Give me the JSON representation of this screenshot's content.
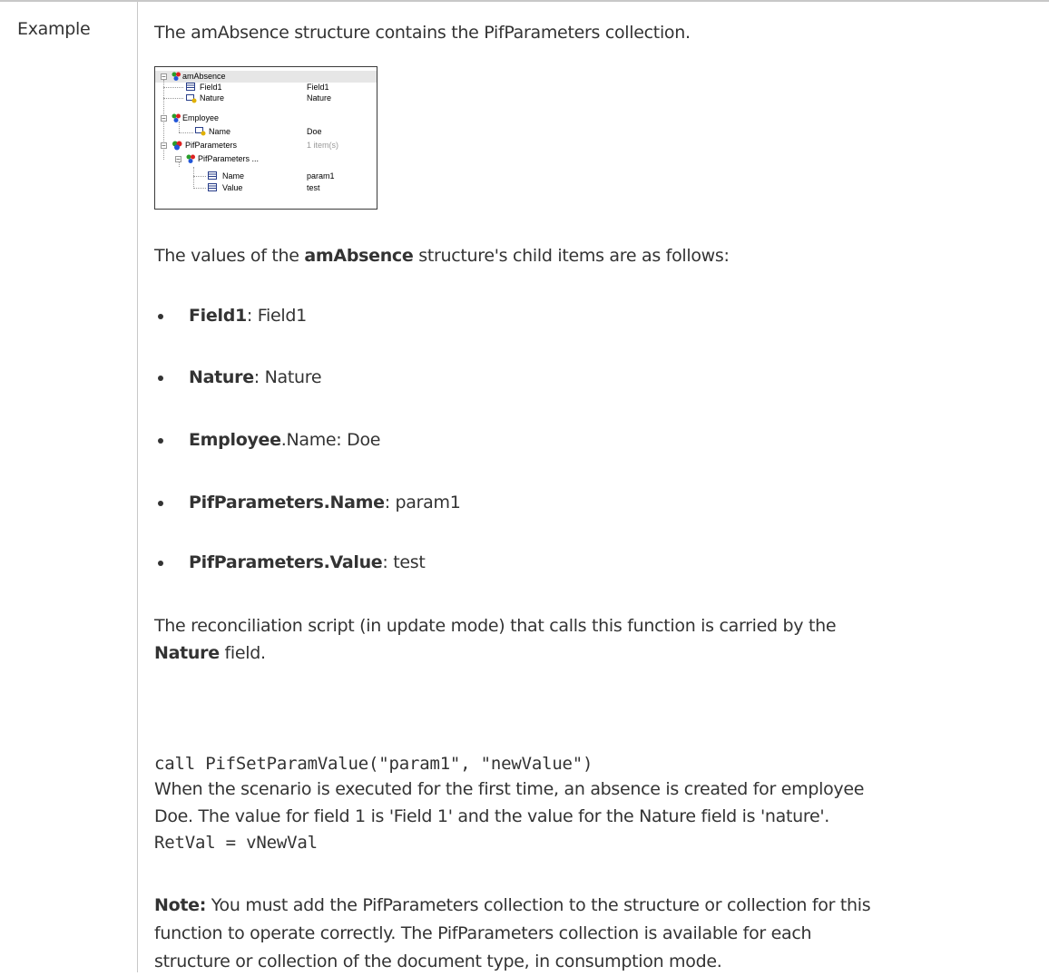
{
  "table": {
    "row_label": "Example"
  },
  "intro": "The amAbsence structure contains the PifParameters collection.",
  "tree": {
    "rows": [
      {
        "label": "amAbsence",
        "value": ""
      },
      {
        "label": "Field1",
        "value": "Field1"
      },
      {
        "label": "Nature",
        "value": "Nature"
      },
      {
        "label": "Employee",
        "value": ""
      },
      {
        "label": "Name",
        "value": "Doe"
      },
      {
        "label": "PifParameters",
        "value": "1 item(s)"
      },
      {
        "label": "PifParameters ...",
        "value": ""
      },
      {
        "label": "Name",
        "value": "param1"
      },
      {
        "label": "Value",
        "value": "test"
      }
    ]
  },
  "values_intro": {
    "before": "The values of the ",
    "bold": "amAbsence",
    "after": " structure's child items are as follows:"
  },
  "bullets": [
    {
      "bold": "Field1",
      "rest": ": Field1"
    },
    {
      "bold": "Nature",
      "rest": ": Nature"
    },
    {
      "bold": "Employee",
      "rest": ".Name: Doe"
    },
    {
      "bold": "PifParameters.Name",
      "rest": ": param1"
    },
    {
      "bold": "PifParameters.Value",
      "rest": ": test"
    }
  ],
  "reconciliation": {
    "line1": "The reconciliation script (in update mode) that calls this function is carried by the",
    "bold": "Nature",
    "after": " field."
  },
  "code": {
    "line1": "call PifSetParamValue(\"param1\", \"newValue\")",
    "line2": "RetVal = vNewVal"
  },
  "execution": {
    "line1": "When the scenario is executed for the first time, an absence is created for employee",
    "line2": "Doe. The value for field 1 is 'Field 1' and the value for the Nature field is 'nature'."
  },
  "note": {
    "label": "Note:",
    "line1": " You must add the PifParameters collection to the structure or collection for this",
    "line2": "function to operate correctly. The PifParameters collection is available for each",
    "line3": "structure or collection of the document type, in consumption mode."
  }
}
